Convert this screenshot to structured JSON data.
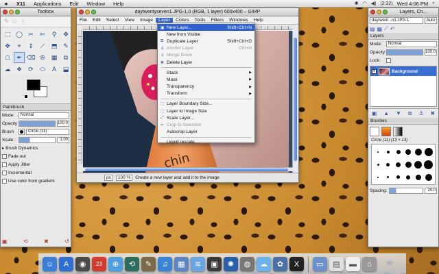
{
  "menubar": {
    "apple": "",
    "items": [
      "X11",
      "Applications",
      "Edit",
      "Window",
      "Help"
    ],
    "right": {
      "time": "(2:32)",
      "clock": "Wed 4:06 PM",
      "spotlight": "⌕",
      "volume": "◀)",
      "wifi": "◠",
      "bluetooth": "✱"
    }
  },
  "toolbox": {
    "title": "Toolbox",
    "tools": [
      "⬚",
      "◯",
      "✂",
      "✄",
      "⚲",
      "✥",
      "✥",
      "⌖",
      "⇕",
      "⟋",
      "⬒",
      "✎",
      "☖",
      "✒",
      "⌫",
      "✇",
      "▦",
      "⧉",
      "☁",
      "❖",
      "⟳",
      "⬭",
      "A",
      "⬓"
    ],
    "options_title": "Paintbrush",
    "mode_label": "Mode:",
    "mode_value": "Normal",
    "opacity_label": "Opacity",
    "opacity_value": "100.0",
    "brush_label": "Brush",
    "brush_value": "Circle (11)",
    "scale_label": "Scale:",
    "scale_value": "1.00",
    "dynamics_label": "▸ Brush Dynamics",
    "fade_label": "Fade out",
    "jitter_label": "Apply Jitter",
    "incremental_label": "Incremental",
    "gradient_label": "Use color from gradient",
    "opacity": 1.0
  },
  "imgwin": {
    "title": "daytwentyseven1.JPG-1.0 (RGB, 1 layer) 600x400 – GIMP",
    "menus": [
      "File",
      "Edit",
      "Select",
      "View",
      "Image",
      "Layer",
      "Colors",
      "Tools",
      "Filters",
      "Windows",
      "Help"
    ],
    "active_menu": "Layer",
    "unit": "px",
    "zoom": "100 %",
    "status": "Create a new layer and add it to the image"
  },
  "layer_menu": [
    {
      "label": "New Layer...",
      "shortcut": "Shift+Ctrl+N",
      "icon": "▣",
      "state": "highlight"
    },
    {
      "label": "New from Visible",
      "shortcut": "",
      "icon": "",
      "state": "normal"
    },
    {
      "label": "Duplicate Layer",
      "shortcut": "Shift+Ctrl+D",
      "icon": "⧉",
      "state": "normal"
    },
    {
      "label": "Anchor Layer",
      "shortcut": "Ctrl+H",
      "icon": "⚓",
      "state": "disabled"
    },
    {
      "label": "Merge Down",
      "shortcut": "",
      "icon": "⇓",
      "state": "disabled"
    },
    {
      "label": "Delete Layer",
      "shortcut": "",
      "icon": "✖",
      "state": "normal"
    },
    {
      "sep": true
    },
    {
      "label": "Stack",
      "shortcut": "",
      "icon": "",
      "state": "normal",
      "submenu": true
    },
    {
      "label": "Mask",
      "shortcut": "",
      "icon": "",
      "state": "normal",
      "submenu": true
    },
    {
      "label": "Transparency",
      "shortcut": "",
      "icon": "",
      "state": "normal",
      "submenu": true
    },
    {
      "label": "Transform",
      "shortcut": "",
      "icon": "",
      "state": "normal",
      "submenu": true
    },
    {
      "sep": true
    },
    {
      "label": "Layer Boundary Size...",
      "shortcut": "",
      "icon": "⬚",
      "state": "normal"
    },
    {
      "label": "Layer to Image Size",
      "shortcut": "",
      "icon": "⬚",
      "state": "normal"
    },
    {
      "label": "Scale Layer...",
      "shortcut": "",
      "icon": "⤢",
      "state": "normal"
    },
    {
      "label": "Crop to Selection",
      "shortcut": "",
      "icon": "✂",
      "state": "disabled"
    },
    {
      "label": "Autocrop Layer",
      "shortcut": "",
      "icon": "",
      "state": "normal"
    },
    {
      "sep": true
    },
    {
      "label": "Liquid rescale...",
      "shortcut": "",
      "icon": "",
      "state": "normal"
    }
  ],
  "layersdock": {
    "title": "Layers, Ch...",
    "image_combo": "daytwent...n1.JPG-1",
    "auto_label": "Auto",
    "panel_title": "Layers",
    "mode_label": "Mode:",
    "mode_value": "Normal",
    "opacity_label": "Opacity:",
    "opacity_value": "100.0",
    "lock_label": "Lock:",
    "layer_name": "Background",
    "brushes_title": "Brushes",
    "brush_name": "Circle (11) (13 × 13)",
    "spacing_label": "Spacing:",
    "spacing_value": "20.0"
  },
  "dock": {
    "icons": [
      {
        "name": "finder-icon",
        "glyph": "☺",
        "color": "#3b7fd9"
      },
      {
        "name": "appstore-icon",
        "glyph": "A",
        "color": "#2d6fd3"
      },
      {
        "name": "dashboard-icon",
        "glyph": "◉",
        "color": "#4a4a4a"
      },
      {
        "name": "calendar-icon",
        "glyph": "23",
        "color": "#d23b30"
      },
      {
        "name": "safari-icon",
        "glyph": "⊕",
        "color": "#4fa0e0"
      },
      {
        "name": "timemachine-icon",
        "glyph": "⟲",
        "color": "#2b6c5a"
      },
      {
        "name": "gimp-icon",
        "glyph": "✎",
        "color": "#7a6a4a"
      },
      {
        "name": "itunes-icon",
        "glyph": "♫",
        "color": "#3a84d6"
      },
      {
        "name": "preview-icon",
        "glyph": "▦",
        "color": "#5a87c3"
      },
      {
        "name": "network-icon",
        "glyph": "≋",
        "color": "#6aa6e2"
      },
      {
        "name": "photos-icon",
        "glyph": "▣",
        "color": "#3a3a3a"
      },
      {
        "name": "burn-icon",
        "glyph": "✺",
        "color": "#2a5fa8"
      },
      {
        "name": "camera-icon",
        "glyph": "◍",
        "color": "#777"
      },
      {
        "name": "cloud-icon",
        "glyph": "☁",
        "color": "#6bb3ef"
      },
      {
        "name": "iphoto-icon",
        "glyph": "✿",
        "color": "#4a70a8"
      },
      {
        "name": "x11-icon",
        "glyph": "X",
        "color": "#222"
      }
    ],
    "right_icons": [
      {
        "name": "applications-folder-icon",
        "glyph": "▭",
        "color": "#6b93c9"
      },
      {
        "name": "documents-icon",
        "glyph": "▤",
        "color": "#e0e0e0"
      },
      {
        "name": "stack-icon",
        "glyph": "▬",
        "color": "#f0f0f0"
      },
      {
        "name": "trash-icon",
        "glyph": "⌂",
        "color": "#9a9a9a"
      }
    ]
  }
}
